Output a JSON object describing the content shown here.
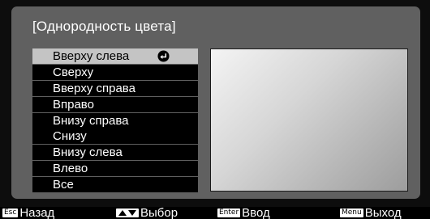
{
  "dialog": {
    "title": "[Однородность цвета]"
  },
  "menu": {
    "items": [
      {
        "label": "Вверху слева",
        "selected": true
      },
      {
        "label": "Сверху"
      },
      {
        "label": "Вверху справа"
      },
      {
        "label": "Вправо"
      },
      {
        "label": "Внизу справа"
      },
      {
        "label": "Снизу"
      },
      {
        "label": "Внизу слева"
      },
      {
        "label": "Влево"
      },
      {
        "label": "Все"
      }
    ],
    "enter_icon": "enter-arrow-icon"
  },
  "footer": {
    "back": {
      "key": "Esc",
      "label": "Назад"
    },
    "select": {
      "key_icon": "up-down-arrows-icon",
      "label": "Выбор"
    },
    "enter": {
      "key": "Enter",
      "label": "Ввод"
    },
    "exit": {
      "key": "Menu",
      "label": "Выход"
    }
  },
  "colors": {
    "background": "#0d0d0d",
    "panel": "#606060",
    "menu_item": "#000000",
    "menu_item_selected": "#c4c4c4"
  }
}
